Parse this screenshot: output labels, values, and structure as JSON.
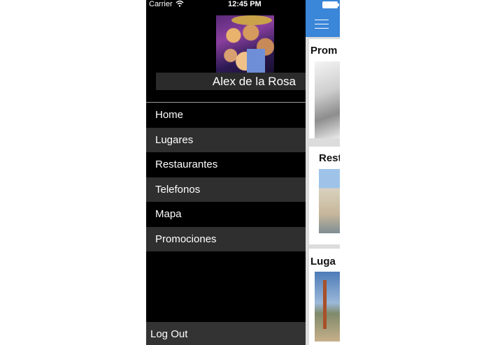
{
  "status_bar": {
    "carrier": "Carrier",
    "wifi_icon": "wifi-icon",
    "time": "12:45 PM",
    "battery_icon": "battery-icon"
  },
  "drawer": {
    "user_name": "Alex de la Rosa",
    "menu": [
      {
        "label": "Home"
      },
      {
        "label": "Lugares"
      },
      {
        "label": "Restaurantes"
      },
      {
        "label": "Telefonos"
      },
      {
        "label": "Mapa"
      },
      {
        "label": "Promociones"
      }
    ],
    "logout_label": "Log Out"
  },
  "main": {
    "navbar_color": "#3a86d8",
    "menu_icon": "hamburger-menu-icon",
    "cards": [
      {
        "title": "Prom"
      },
      {
        "title": "Rest"
      },
      {
        "title": "Luga"
      }
    ]
  }
}
